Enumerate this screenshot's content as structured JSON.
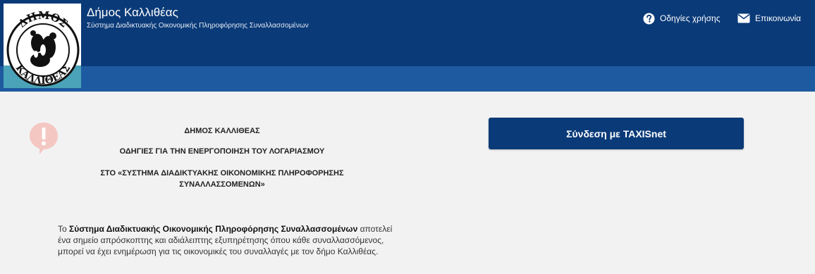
{
  "header": {
    "title": "Δήμος Καλλιθέας",
    "subtitle": "Σύστημα Διαδικτυακής Οικονομικής Πληροφόρησης Συναλλασσομένων",
    "logo_icon": "municipality-seal-icon",
    "logo_text": "ΔΗΜΟΣ ΚΑΛΛΙΘΕΑΣ",
    "nav": {
      "help_label": "Οδηγίες χρήσης",
      "help_icon": "question-circle-icon",
      "contact_label": "Επικοινωνία",
      "contact_icon": "envelope-icon"
    }
  },
  "main": {
    "alert_icon": "exclamation-bubble-icon",
    "instructions": {
      "line1": "ΔΗΜΟΣ ΚΑΛΛΙΘΕΑΣ",
      "line2": "ΟΔΗΓΙΕΣ ΓΙΑ ΤΗΝ ΕΝΕΡΓΟΠΟΙΗΣΗ ΤΟΥ ΛΟΓΑΡΙΑΣΜΟΥ",
      "line3": "ΣΤΟ «ΣΥΣΤΗΜΑ ΔΙΑΔΙΚΤΥΑΚΗΣ ΟΙΚΟΝΟΜΙΚΗΣ ΠΛΗΡΟΦΟΡΗΣΗΣ ΣΥΝΑΛΛΑΣΣΟΜΕΝΩΝ»"
    },
    "intro": {
      "prefix": "Το ",
      "bold": "Σύστημα Διαδικτυακής Οικονομικής Πληροφόρησης Συναλλασσομένων",
      "rest": " αποτελεί ένα σημείο απρόσκοπτης και αδιάλειπτης εξυπηρέτησης όπου κάθε συναλλασσόμενος, μπορεί να έχει ενημέρωση για τις οικονομικές του συναλλαγές με τον δήμο Καλλιθέας."
    },
    "login_button_label": "Σύνδεση με TAXISnet"
  },
  "colors": {
    "header_dark": "#0a3a78",
    "header_band": "#1e5aa0",
    "logo_teal": "#4aa3b8",
    "alert_pink": "#f4c7c2",
    "background": "#f2f2f2"
  }
}
